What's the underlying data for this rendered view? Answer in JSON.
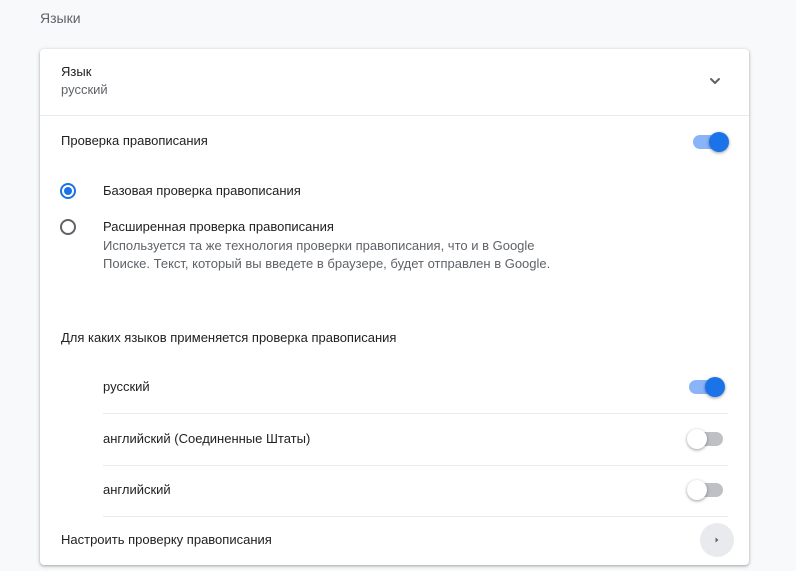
{
  "section_title": "Языки",
  "language": {
    "label": "Язык",
    "value": "русский",
    "icon": "chevron-down-icon"
  },
  "spellcheck": {
    "label": "Проверка правописания",
    "enabled": true,
    "options": [
      {
        "label": "Базовая проверка правописания",
        "checked": true
      },
      {
        "label": "Расширенная проверка правописания",
        "checked": false,
        "description": "Используется та же технология проверки правописания, что и в Google Поиске. Текст, который вы введете в браузере, будет отправлен в Google."
      }
    ]
  },
  "languages_heading": "Для каких языков применяется проверка правописания",
  "languages": [
    {
      "name": "русский",
      "enabled": true
    },
    {
      "name": "английский (Соединенные Штаты)",
      "enabled": false
    },
    {
      "name": "английский",
      "enabled": false
    }
  ],
  "customize": {
    "label": "Настроить проверку правописания",
    "icon": "arrow-right-icon"
  },
  "colors": {
    "accent": "#1a73e8",
    "accent_light": "#8ab4f8"
  }
}
